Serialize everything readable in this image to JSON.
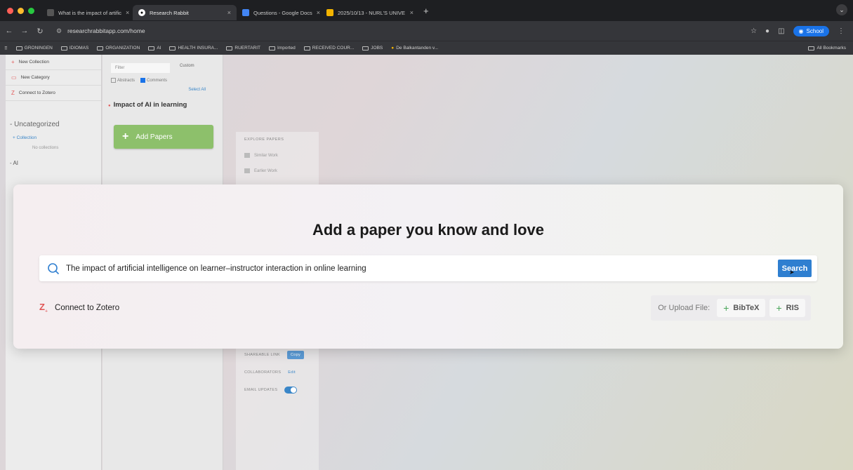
{
  "browser": {
    "tabs": [
      {
        "title": "What is the impact of artific",
        "active": false
      },
      {
        "title": "Research Rabbit",
        "active": true
      },
      {
        "title": "Questions - Google Docs",
        "active": false
      },
      {
        "title": "2025/10/13 - NURL'S UNIVE",
        "active": false
      }
    ],
    "url": "researchrabbitapp.com/home",
    "profile": "School",
    "bookmarks": [
      "GRONINGEN",
      "IDIOMAS",
      "ORGANIZATION",
      "AI",
      "HEALTH INSURA...",
      "RUERTARIT",
      "Imported",
      "RECEIVED COUR...",
      "JOBS",
      "De Balkantanden v..."
    ],
    "all_bookmarks": "All Bookmarks"
  },
  "sidebar": {
    "items": [
      {
        "label": "New Collection"
      },
      {
        "label": "New Category"
      },
      {
        "label": "Connect to Zotero"
      }
    ],
    "uncategorized": "- Uncategorized",
    "collection": "+ Collection",
    "no_collections": "No collections",
    "ai_label": "- AI"
  },
  "panel": {
    "filter_placeholder": "Filter",
    "custom": "Custom",
    "abstracts": "Abstracts",
    "comments": "Comments",
    "select_all": "Select All",
    "collection_title": "Impact of AI in learning",
    "add_papers": "Add Papers"
  },
  "explore": {
    "heading": "EXPLORE PAPERS",
    "items": [
      "Similar Work",
      "Earlier Work"
    ],
    "shareable_link": "SHAREABLE LINK",
    "copy": "Copy",
    "collaborators": "COLLABORATORS",
    "edit": "Edit",
    "email_updates": "EMAIL UPDATES"
  },
  "modal": {
    "title": "Add a paper you know and love",
    "search_value": "The impact of artificial intelligence on learner–instructor interaction in online learning",
    "search_button": "Search",
    "zotero": "Connect to Zotero",
    "upload_label": "Or Upload File:",
    "bibtex": "BibTeX",
    "ris": "RIS"
  },
  "colors": {
    "accent": "#2f7fd0",
    "add_papers_green": "#8dc06b",
    "zotero_red": "#e05555"
  }
}
